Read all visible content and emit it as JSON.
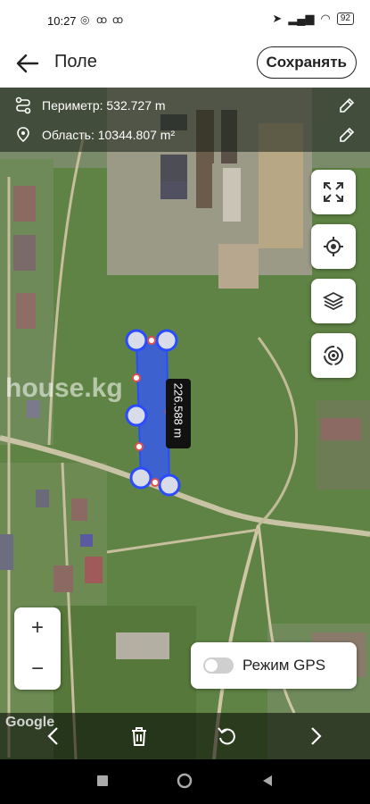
{
  "status_bar": {
    "time": "10:27",
    "battery": "92"
  },
  "app_bar": {
    "title": "Поле",
    "save_label": "Сохранять"
  },
  "info": {
    "perimeter": "Периметр: 532.727 m",
    "area": "Область: 10344.807 m²"
  },
  "map": {
    "edge_label": "226.588 m",
    "watermark": "house.kg",
    "attribution": "Google"
  },
  "zoom": {
    "plus": "+",
    "minus": "−"
  },
  "gps": {
    "label": "Режим GPS"
  },
  "colors": {
    "polygon_fill": "#3355ff",
    "polygon_opacity": "0.75",
    "map_base": "#5d7d43"
  }
}
